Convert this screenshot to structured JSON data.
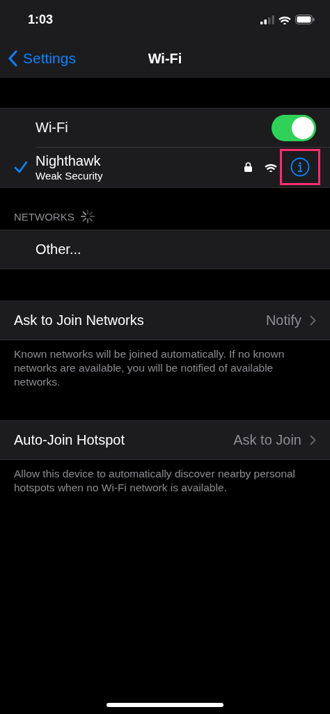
{
  "status_bar": {
    "time": "1:03"
  },
  "nav": {
    "back": "Settings",
    "title": "Wi-Fi"
  },
  "wifi_toggle": {
    "label": "Wi-Fi",
    "on": true
  },
  "current_network": {
    "name": "Nighthawk",
    "subtitle": "Weak Security",
    "connected": true,
    "locked": true,
    "info_highlighted": true
  },
  "networks_header": {
    "label": "NETWORKS",
    "loading": true
  },
  "networks": [
    {
      "label": "Other..."
    }
  ],
  "settings": [
    {
      "label": "Ask to Join Networks",
      "value": "Notify",
      "footer": "Known networks will be joined automatically. If no known networks are available, you will be notified of available networks."
    },
    {
      "label": "Auto-Join Hotspot",
      "value": "Ask to Join",
      "footer": "Allow this device to automatically discover nearby personal hotspots when no Wi-Fi network is available."
    }
  ]
}
